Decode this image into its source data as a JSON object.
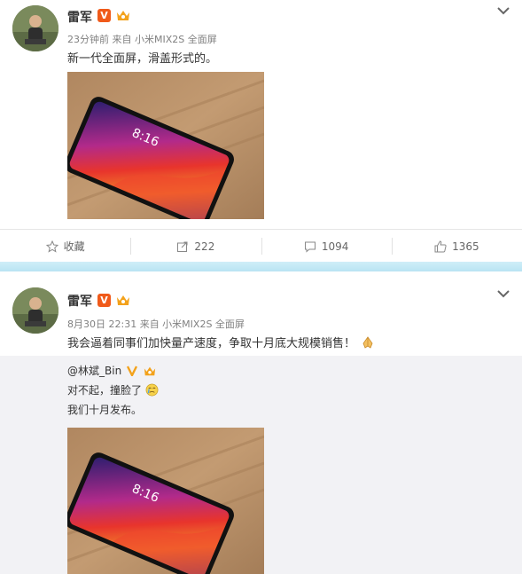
{
  "posts": [
    {
      "author": "雷军",
      "verified_badge": "V",
      "meta": "23分钟前 来自 小米MIX2S 全面屏",
      "text": "新一代全面屏，滑盖形式的。",
      "phone_time": "8:16"
    },
    {
      "author": "雷军",
      "verified_badge": "V",
      "meta": "8月30日 22:31 来自 小米MIX2S 全面屏",
      "text": "我会逼着同事们加快量产速度，争取十月底大规模销售！",
      "repost": {
        "user": "@林斌_Bin",
        "line1": "对不起，撞脸了",
        "line2": "我们十月发布。",
        "phone_time": "8:16"
      }
    }
  ],
  "actions": {
    "favorite_label": "收藏",
    "repost_count": "222",
    "comment_count": "1094",
    "like_count": "1365"
  },
  "icons": [
    "chevron-down-icon",
    "v-badge-icon",
    "crown-icon",
    "star-icon",
    "share-icon",
    "comment-icon",
    "like-icon",
    "pray-emoji-icon",
    "cry-emoji-icon"
  ],
  "colors": {
    "separator": "#c7e9f6",
    "badge": "#f05a1a",
    "crown": "#f3a21b",
    "repost_bg": "#f2f2f5"
  }
}
